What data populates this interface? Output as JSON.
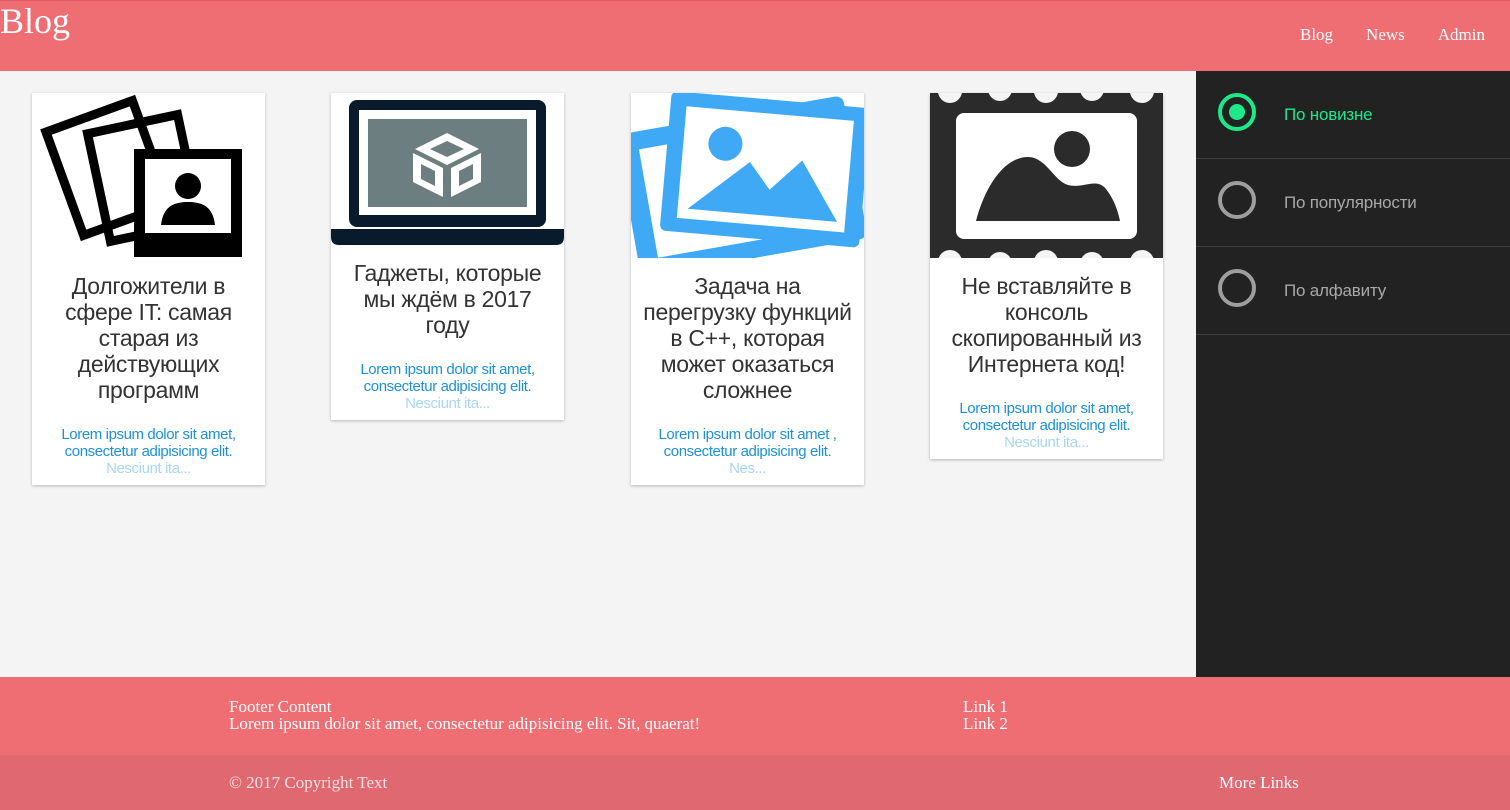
{
  "header": {
    "brand": "Blog",
    "nav": [
      "Blog",
      "News",
      "Admin"
    ],
    "color": "#ef6e74"
  },
  "cards": [
    {
      "image_icon": "polaroid-photos-icon",
      "title": "Долгожители в сфере IT: самая старая из действующих программ",
      "excerpt": "Lorem ipsum dolor sit amet, consectetur adipisicing elit.",
      "excerpt_faded": "Nesciunt ita..."
    },
    {
      "image_icon": "laptop-box-icon",
      "title": "Гаджеты, которые мы ждём в 2017 году",
      "excerpt": "Lorem ipsum dolor sit amet, consectetur adipisicing elit.",
      "excerpt_faded": "Nesciunt ita..."
    },
    {
      "image_icon": "image-gallery-icon",
      "title": "Задача на перегрузку функций в C++, которая может оказаться сложнее",
      "excerpt": "Lorem ipsum dolor sit amet , consectetur adipisicing elit.",
      "excerpt_faded": "Nes..."
    },
    {
      "image_icon": "framed-picture-icon",
      "title": "Не вставляйте в консоль скопированный из Интернета код!",
      "excerpt": "Lorem ipsum dolor sit amet, consectetur adipisicing elit.",
      "excerpt_faded": "Nesciunt ita..."
    }
  ],
  "sort": {
    "options": [
      "По новизне",
      "По популярности",
      "По алфавиту"
    ],
    "selected": "По новизне",
    "accent": "#1de98b"
  },
  "footer": {
    "title": "Footer Content",
    "text": "Lorem ipsum dolor sit amet, consectetur adipisicing elit. Sit, quaerat!",
    "links": [
      "Link 1",
      "Link 2"
    ],
    "copyright": "© 2017 Copyright Text",
    "more_links": "More Links"
  }
}
